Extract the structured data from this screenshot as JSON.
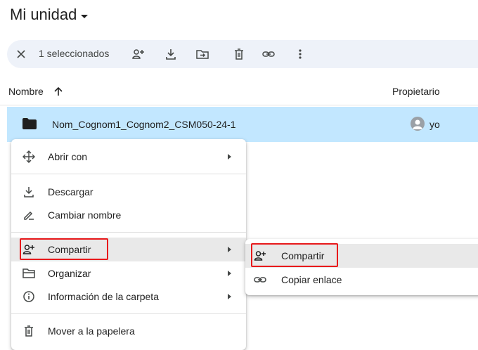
{
  "header": {
    "title": "Mi unidad"
  },
  "action_bar": {
    "selected_count": "1 seleccionados",
    "icons": [
      "close-icon",
      "share-icon",
      "download-icon",
      "move-icon",
      "trash-icon",
      "link-icon",
      "more-icon"
    ]
  },
  "columns": {
    "name": "Nombre",
    "owner": "Propietario"
  },
  "file": {
    "name": "Nom_Cognom1_Cognom2_CSM050-24-1",
    "owner": "yo"
  },
  "context_menu": {
    "items": [
      {
        "label": "Abrir con",
        "icon": "open-with-icon",
        "submenu": true
      },
      {
        "label": "Descargar",
        "icon": "download-icon",
        "submenu": false
      },
      {
        "label": "Cambiar nombre",
        "icon": "rename-icon",
        "submenu": false
      },
      {
        "label": "Compartir",
        "icon": "share-icon",
        "submenu": true
      },
      {
        "label": "Organizar",
        "icon": "folder-icon",
        "submenu": true
      },
      {
        "label": "Información de la carpeta",
        "icon": "info-icon",
        "submenu": true
      },
      {
        "label": "Mover a la papelera",
        "icon": "trash-icon",
        "submenu": false
      }
    ]
  },
  "share_submenu": {
    "items": [
      {
        "label": "Compartir",
        "icon": "share-icon"
      },
      {
        "label": "Copiar enlace",
        "icon": "link-icon"
      }
    ]
  },
  "colors": {
    "selection": "#c2e7ff",
    "action_bar": "#eef2f9",
    "highlight_box": "#e8191b",
    "hover": "#e9e9e9"
  }
}
